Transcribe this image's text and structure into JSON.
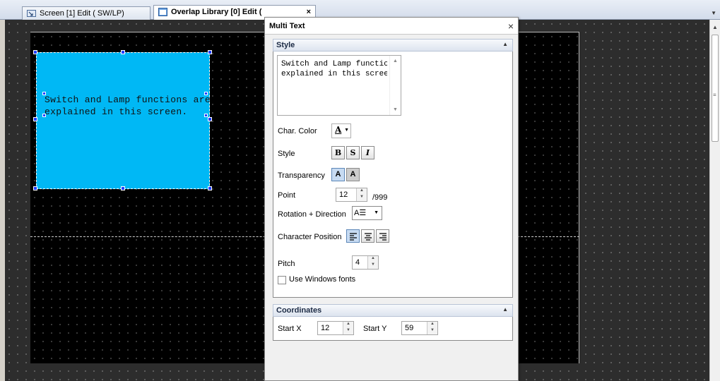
{
  "tabs": [
    {
      "label": "Screen [1] Edit (      SW/LP)",
      "icon": "screen-icon"
    },
    {
      "label": "Overlap Library [0] Edit (",
      "icon": "library-icon",
      "close": "×"
    }
  ],
  "canvas": {
    "object_text_line1": "Switch and Lamp functions are",
    "object_text_line2": "explained in this screen."
  },
  "panel": {
    "title": "Multi Text",
    "close": "×",
    "style_section": {
      "header": "Style",
      "text_preview": "Switch and Lamp functio\nexplained in this scree",
      "char_color_label": "Char. Color",
      "char_color_glyph": "A",
      "style_label": "Style",
      "style_buttons": [
        "B",
        "S",
        "I"
      ],
      "transparency_label": "Transparency",
      "transparency_buttons": [
        "A",
        "A"
      ],
      "point_label": "Point",
      "point_value": "12",
      "point_max": "/999",
      "rotation_label": "Rotation + Direction",
      "rotation_icon": "A☰",
      "char_position_label": "Character Position",
      "pitch_label": "Pitch",
      "pitch_value": "4",
      "windows_fonts_label": "Use Windows fonts"
    },
    "coordinates_section": {
      "header": "Coordinates",
      "start_x_label": "Start X",
      "start_x_value": "12",
      "start_y_label": "Start Y",
      "start_y_value": "59"
    }
  },
  "colors": {
    "object_fill": "#00b8f5",
    "canvas_bg": "#000000",
    "workspace_bg": "#2d2d2d",
    "handle": "#2040ff"
  }
}
